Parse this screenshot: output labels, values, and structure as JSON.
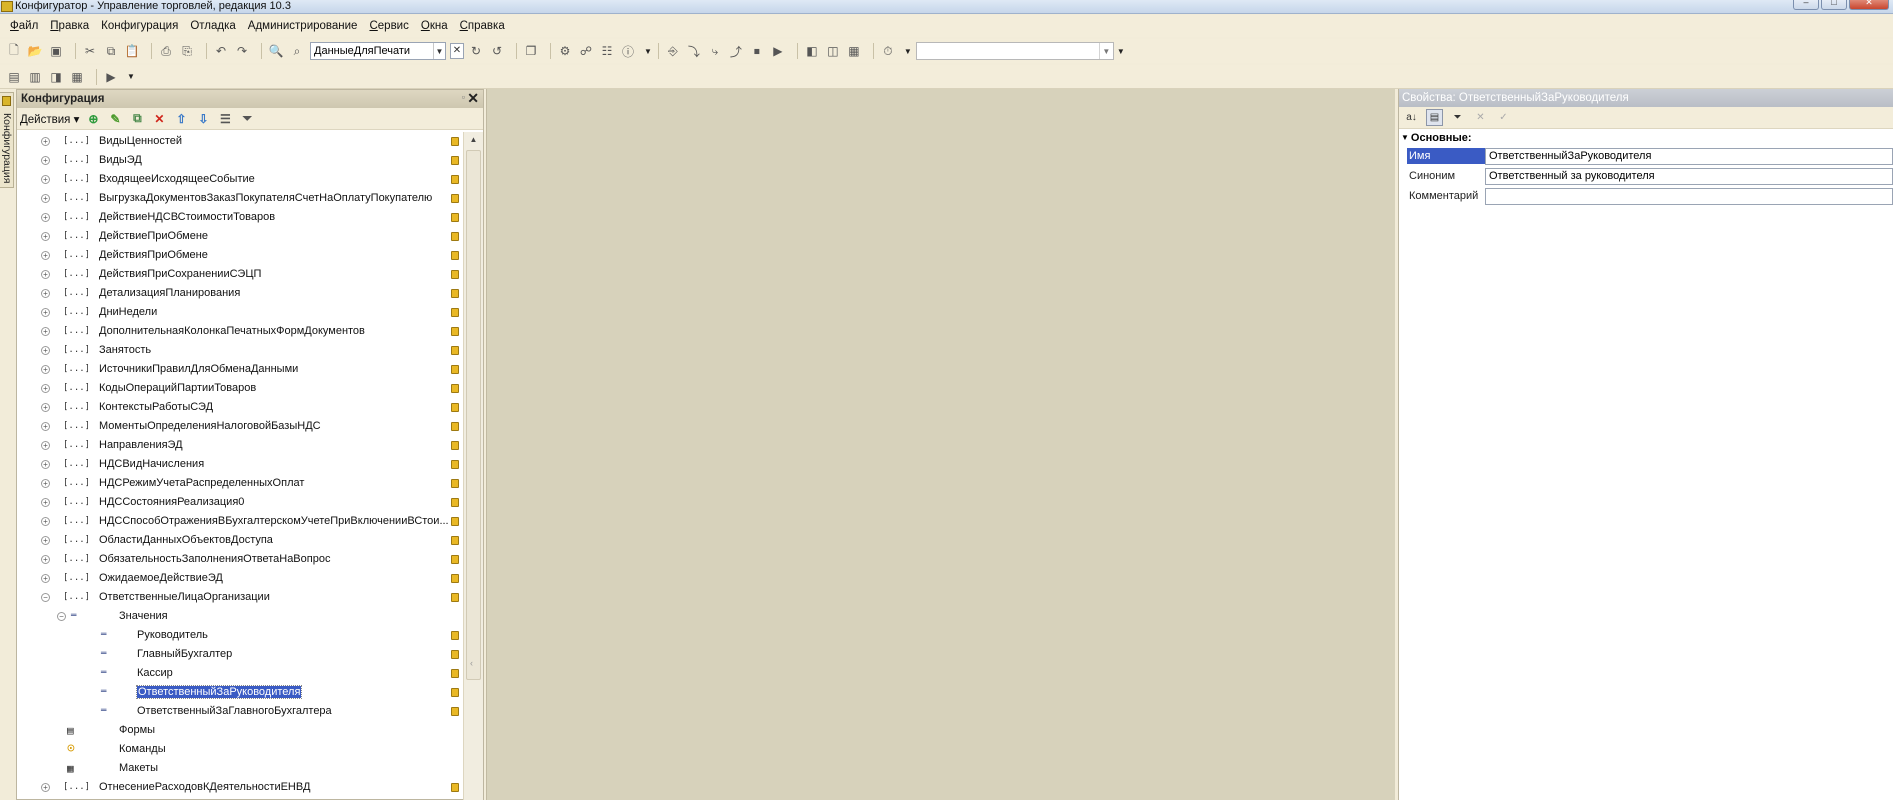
{
  "window": {
    "title": "Конфигуратор - Управление торговлей, редакция 10.3"
  },
  "menu": {
    "items": [
      {
        "u": "Ф",
        "rest": "айл"
      },
      {
        "u": "П",
        "rest": "равка"
      },
      {
        "u": "",
        "rest": "Конфигурация"
      },
      {
        "u": "",
        "rest": "Отладка"
      },
      {
        "u": "",
        "rest": "Администрирование"
      },
      {
        "u": "С",
        "rest": "ервис"
      },
      {
        "u": "О",
        "rest": "кна"
      },
      {
        "u": "С",
        "rest": "правка"
      }
    ]
  },
  "toolbar": {
    "search_combo_value": "ДанныеДляПечати"
  },
  "left_tab": {
    "label": "Конфигурация"
  },
  "config_panel": {
    "title": "Конфигурация",
    "actions_label": "Действия"
  },
  "tree": [
    {
      "text": "ВидыЦенностей",
      "level": 0,
      "exp": "+",
      "icon": "enum",
      "lock": true
    },
    {
      "text": "ВидыЭД",
      "level": 0,
      "exp": "+",
      "icon": "enum",
      "lock": true
    },
    {
      "text": "ВходящееИсходящееСобытие",
      "level": 0,
      "exp": "+",
      "icon": "enum",
      "lock": true
    },
    {
      "text": "ВыгрузкаДокументовЗаказПокупателяСчетНаОплатуПокупателю",
      "level": 0,
      "exp": "+",
      "icon": "enum",
      "lock": true
    },
    {
      "text": "ДействиеНДСВСтоимостиТоваров",
      "level": 0,
      "exp": "+",
      "icon": "enum",
      "lock": true
    },
    {
      "text": "ДействиеПриОбмене",
      "level": 0,
      "exp": "+",
      "icon": "enum",
      "lock": true
    },
    {
      "text": "ДействияПриОбмене",
      "level": 0,
      "exp": "+",
      "icon": "enum",
      "lock": true
    },
    {
      "text": "ДействияПриСохраненииСЭЦП",
      "level": 0,
      "exp": "+",
      "icon": "enum",
      "lock": true
    },
    {
      "text": "ДетализацияПланирования",
      "level": 0,
      "exp": "+",
      "icon": "enum",
      "lock": true
    },
    {
      "text": "ДниНедели",
      "level": 0,
      "exp": "+",
      "icon": "enum",
      "lock": true
    },
    {
      "text": "ДополнительнаяКолонкаПечатныхФормДокументов",
      "level": 0,
      "exp": "+",
      "icon": "enum",
      "lock": true
    },
    {
      "text": "Занятость",
      "level": 0,
      "exp": "+",
      "icon": "enum",
      "lock": true
    },
    {
      "text": "ИсточникиПравилДляОбменаДанными",
      "level": 0,
      "exp": "+",
      "icon": "enum",
      "lock": true
    },
    {
      "text": "КодыОперацийПартииТоваров",
      "level": 0,
      "exp": "+",
      "icon": "enum",
      "lock": true
    },
    {
      "text": "КонтекстыРаботыСЭД",
      "level": 0,
      "exp": "+",
      "icon": "enum",
      "lock": true
    },
    {
      "text": "МоментыОпределенияНалоговойБазыНДС",
      "level": 0,
      "exp": "+",
      "icon": "enum",
      "lock": true
    },
    {
      "text": "НаправленияЭД",
      "level": 0,
      "exp": "+",
      "icon": "enum",
      "lock": true
    },
    {
      "text": "НДСВидНачисления",
      "level": 0,
      "exp": "+",
      "icon": "enum",
      "lock": true
    },
    {
      "text": "НДСРежимУчетаРаспределенныхОплат",
      "level": 0,
      "exp": "+",
      "icon": "enum",
      "lock": true
    },
    {
      "text": "НДССостоянияРеализация0",
      "level": 0,
      "exp": "+",
      "icon": "enum",
      "lock": true
    },
    {
      "text": "НДССпособОтраженияВБухгалтерскомУчетеПриВключенииВСтои...",
      "level": 0,
      "exp": "+",
      "icon": "enum",
      "lock": true
    },
    {
      "text": "ОбластиДанныхОбъектовДоступа",
      "level": 0,
      "exp": "+",
      "icon": "enum",
      "lock": true
    },
    {
      "text": "ОбязательностьЗаполненияОтветаНаВопрос",
      "level": 0,
      "exp": "+",
      "icon": "enum",
      "lock": true
    },
    {
      "text": "ОжидаемоеДействиеЭД",
      "level": 0,
      "exp": "+",
      "icon": "enum",
      "lock": true
    },
    {
      "text": "ОтветственныеЛицаОрганизации",
      "level": 0,
      "exp": "−",
      "icon": "enum",
      "lock": true
    },
    {
      "text": "Значения",
      "level": 1,
      "exp": "−",
      "icon": "dash",
      "lock": false
    },
    {
      "text": "Руководитель",
      "level": 2,
      "exp": "",
      "icon": "dash",
      "lock": true
    },
    {
      "text": "ГлавныйБухгалтер",
      "level": 2,
      "exp": "",
      "icon": "dash",
      "lock": true
    },
    {
      "text": "Кассир",
      "level": 2,
      "exp": "",
      "icon": "dash",
      "lock": true
    },
    {
      "text": "ОтветственныйЗаРуководителя",
      "level": 2,
      "exp": "",
      "icon": "dash",
      "lock": true,
      "selected": true
    },
    {
      "text": "ОтветственныйЗаГлавногоБухгалтера",
      "level": 2,
      "exp": "",
      "icon": "dash",
      "lock": true
    },
    {
      "text": "Формы",
      "level": 1,
      "exp": "",
      "icon": "form",
      "lock": false
    },
    {
      "text": "Команды",
      "level": 1,
      "exp": "",
      "icon": "cmd",
      "lock": false
    },
    {
      "text": "Макеты",
      "level": 1,
      "exp": "",
      "icon": "tmpl",
      "lock": false
    },
    {
      "text": "ОтнесениеРасходовКДеятельностиЕНВД",
      "level": 0,
      "exp": "+",
      "icon": "enum",
      "lock": true
    }
  ],
  "properties": {
    "title": "Свойства: ОтветственныйЗаРуководителя",
    "group_label": "Основные:",
    "rows": [
      {
        "name": "Имя",
        "value": "ОтветственныйЗаРуководителя",
        "selected": true
      },
      {
        "name": "Синоним",
        "value": "Ответственный за руководителя",
        "selected": false
      },
      {
        "name": "Комментарий",
        "value": "",
        "selected": false
      }
    ]
  },
  "colors": {
    "selection": "#3a5bc4",
    "workspace": "#d7d2bb",
    "toolbar_bg": "#f3edda",
    "lock_icon": "#e9b825"
  }
}
